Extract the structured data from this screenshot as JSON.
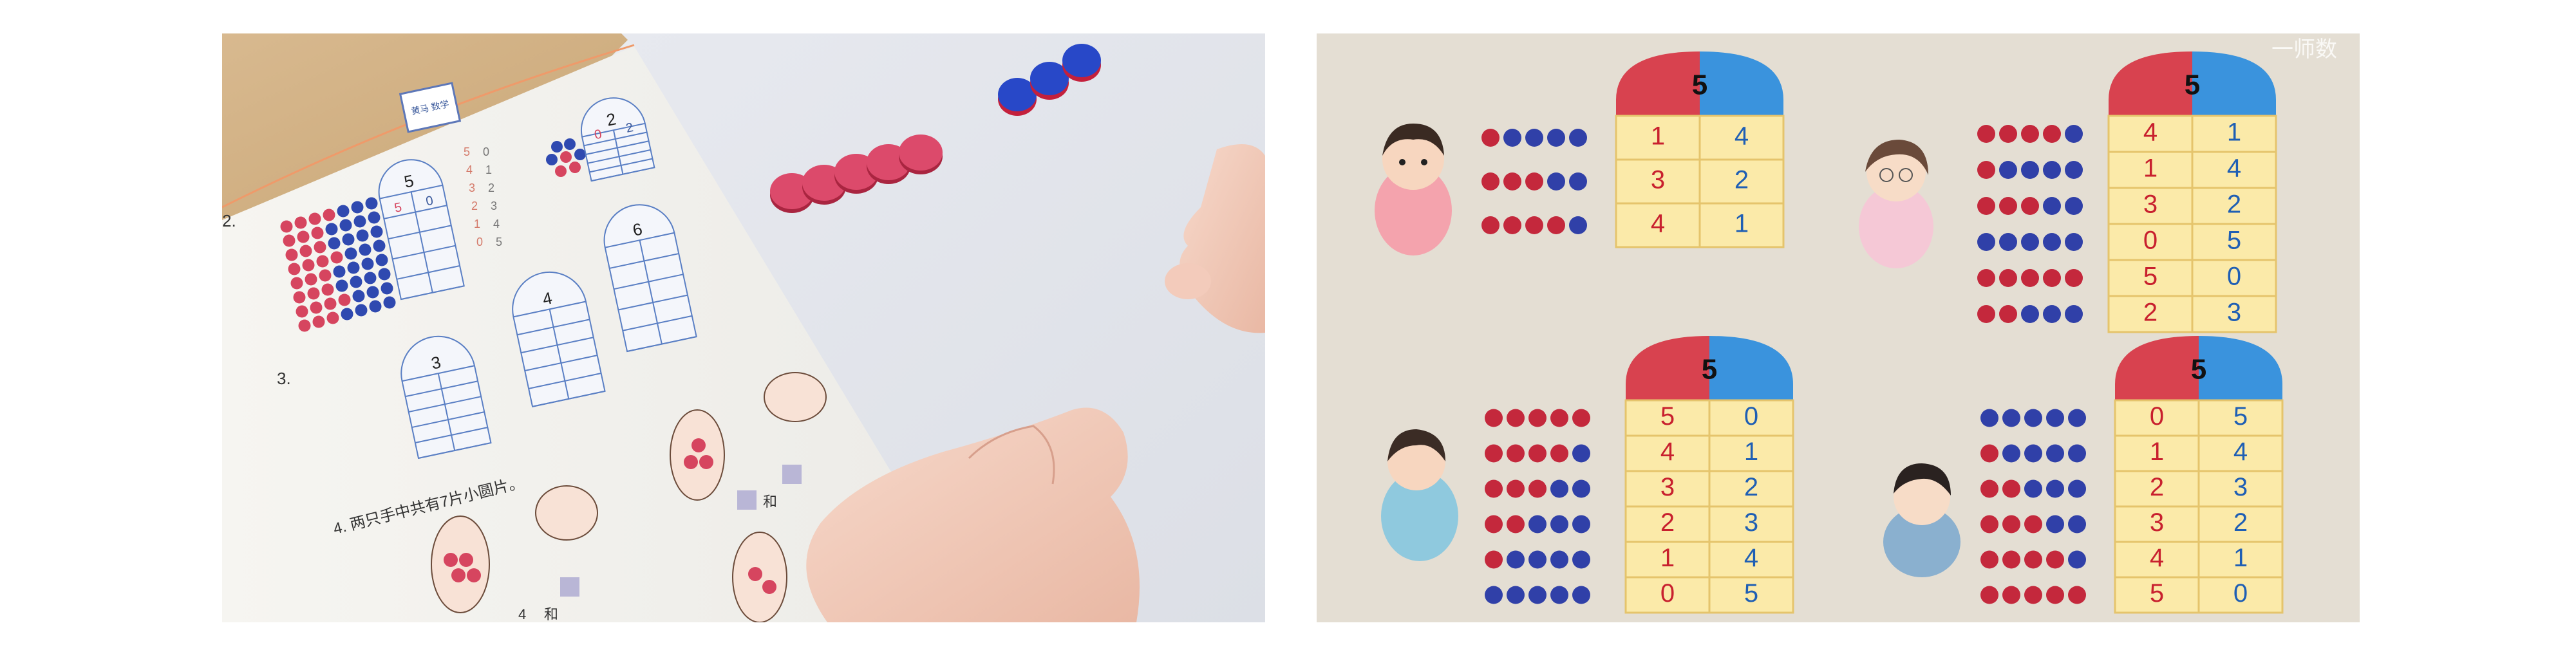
{
  "photo": {
    "stamp_text": "黄马 数学",
    "q2_number": "2.",
    "q3_number": "3.",
    "q4_text": "4. 两只手中共有7片小圆片。",
    "he_1": "和",
    "he_2": "和",
    "small_4": "4",
    "box_5": "5",
    "box_2": "2",
    "box_6": "6",
    "box_4": "4",
    "box_3": "3",
    "box5_row1_left": "5",
    "box5_row1_right": "0",
    "box2_row1_left": "0",
    "box2_row1_right": "2",
    "pencil_col1": [
      "5",
      "4",
      "3",
      "2",
      "1",
      "0"
    ],
    "pencil_col2": [
      "0",
      "1",
      "2",
      "3",
      "4",
      "5"
    ],
    "colors": {
      "red_counter": "#d6455f",
      "blue_counter": "#2f49b0",
      "grid_line": "#5a7fc4"
    }
  },
  "slide": {
    "watermark": "一师数",
    "groups": [
      {
        "total": "5",
        "rows": [
          [
            "1",
            "4"
          ],
          [
            "3",
            "2"
          ],
          [
            "4",
            "1"
          ]
        ]
      },
      {
        "total": "5",
        "rows": [
          [
            "4",
            "1"
          ],
          [
            "1",
            "4"
          ],
          [
            "3",
            "2"
          ],
          [
            "0",
            "5"
          ],
          [
            "5",
            "0"
          ],
          [
            "2",
            "3"
          ]
        ]
      },
      {
        "total": "5",
        "rows": [
          [
            "5",
            "0"
          ],
          [
            "4",
            "1"
          ],
          [
            "3",
            "2"
          ],
          [
            "2",
            "3"
          ],
          [
            "1",
            "4"
          ],
          [
            "0",
            "5"
          ]
        ]
      },
      {
        "total": "5",
        "rows": [
          [
            "0",
            "5"
          ],
          [
            "1",
            "4"
          ],
          [
            "2",
            "3"
          ],
          [
            "3",
            "2"
          ],
          [
            "4",
            "1"
          ],
          [
            "5",
            "0"
          ]
        ]
      }
    ],
    "colors": {
      "red": "#d8424f",
      "blue": "#3a93dd",
      "table_fill": "#fbeaa9",
      "table_line": "#e5c46c",
      "red_text": "#c8202e",
      "blue_text": "#1f5fb4",
      "bead_red": "#c4283c",
      "bead_blue": "#3040a8"
    }
  }
}
